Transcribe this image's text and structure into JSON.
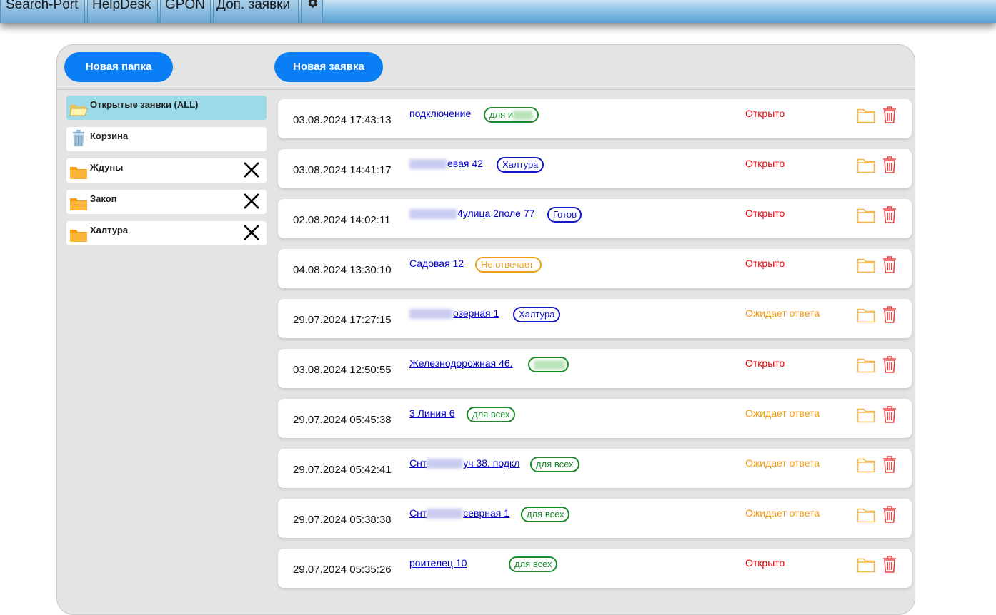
{
  "nav": {
    "items": [
      {
        "label": "Search-Port"
      },
      {
        "label": "HelpDesk"
      },
      {
        "label": "GPON"
      },
      {
        "label": "Доп. заявки"
      }
    ],
    "settings_icon": "gear-icon"
  },
  "toolbar": {
    "new_folder_label": "Новая папка",
    "new_ticket_label": "Новая заявка"
  },
  "folders": [
    {
      "label": "Открытые заявки (ALL)",
      "icon": "folder-open-icon",
      "active": true,
      "deletable": false
    },
    {
      "label": "Корзина",
      "icon": "trash-bin-icon",
      "active": false,
      "deletable": false
    },
    {
      "label": "Ждуны",
      "icon": "folder-icon",
      "active": false,
      "deletable": true
    },
    {
      "label": "Закоп",
      "icon": "folder-icon",
      "active": false,
      "deletable": true
    },
    {
      "label": "Халтура",
      "icon": "folder-icon",
      "active": false,
      "deletable": true
    }
  ],
  "tickets": [
    {
      "date": "03.08.2024 17:43:13",
      "title": "подключение",
      "tag": "для и",
      "status": "Открыто"
    },
    {
      "date": "03.08.2024 14:41:17",
      "title": "евая 42",
      "tag": "Халтура",
      "status": "Открыто"
    },
    {
      "date": "02.08.2024 14:02:11",
      "title": "4улица 2поле 77",
      "tag": "Готов",
      "status": "Открыто"
    },
    {
      "date": "04.08.2024 13:30:10",
      "title": "Садовая 12",
      "tag": "Не отвечает",
      "status": "Открыто"
    },
    {
      "date": "29.07.2024 17:27:15",
      "title": "озерная 1",
      "tag": "Халтура",
      "status": "Ожидает ответа"
    },
    {
      "date": "03.08.2024 12:50:55",
      "title": "Железнодорожная 46.",
      "tag": "",
      "status": "Открыто"
    },
    {
      "date": "29.07.2024 05:45:38",
      "title": "3 Линия 6",
      "tag": "для всех",
      "status": "Ожидает ответа"
    },
    {
      "date": "29.07.2024 05:42:41",
      "title_prefix": "Снт",
      "title": "уч 38. подкл",
      "tag": "для всех",
      "status": "Ожидает ответа"
    },
    {
      "date": "29.07.2024 05:38:38",
      "title_prefix": "Снт",
      "title": "севрная 1",
      "tag": "для всех",
      "status": "Ожидает ответа"
    },
    {
      "date": "29.07.2024 05:35:26",
      "title": "роителец 10",
      "tag": "для всех",
      "status": "Открыто"
    }
  ],
  "colors": {
    "status_open": "#e8000b",
    "status_waiting": "#f29a12",
    "tag_green": "#1a8a2b",
    "tag_blue": "#1515c8",
    "tag_orange": "#e8a21a",
    "accent": "#0a7ef5"
  }
}
